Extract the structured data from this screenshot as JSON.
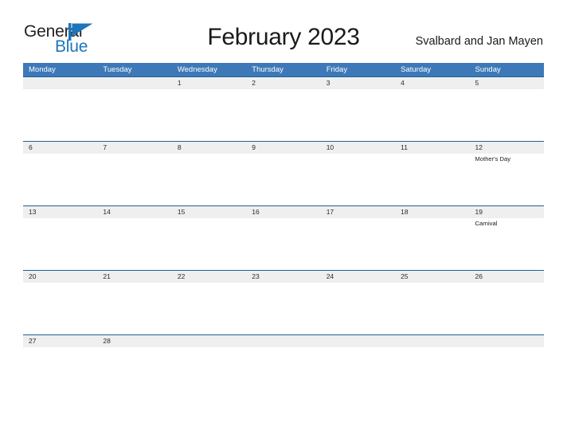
{
  "brand": {
    "name_part1": "General",
    "name_part2": "Blue",
    "flag_color": "#1b76bc",
    "text_color": "#231f20"
  },
  "header": {
    "title": "February 2023",
    "location": "Svalbard and Jan Mayen"
  },
  "theme": {
    "header_bar_color": "#3d79b8",
    "row_divider_color": "#1f6093",
    "date_strip_color": "#efefef",
    "page_background": "#ffffff"
  },
  "calendar": {
    "weekdays": [
      "Monday",
      "Tuesday",
      "Wednesday",
      "Thursday",
      "Friday",
      "Saturday",
      "Sunday"
    ],
    "weeks": [
      {
        "dates": [
          "",
          "",
          "1",
          "2",
          "3",
          "4",
          "5"
        ],
        "events": [
          "",
          "",
          "",
          "",
          "",
          "",
          ""
        ]
      },
      {
        "dates": [
          "6",
          "7",
          "8",
          "9",
          "10",
          "11",
          "12"
        ],
        "events": [
          "",
          "",
          "",
          "",
          "",
          "",
          "Mother's Day"
        ]
      },
      {
        "dates": [
          "13",
          "14",
          "15",
          "16",
          "17",
          "18",
          "19"
        ],
        "events": [
          "",
          "",
          "",
          "",
          "",
          "",
          "Carnival"
        ]
      },
      {
        "dates": [
          "20",
          "21",
          "22",
          "23",
          "24",
          "25",
          "26"
        ],
        "events": [
          "",
          "",
          "",
          "",
          "",
          "",
          ""
        ]
      },
      {
        "dates": [
          "27",
          "28",
          "",
          "",
          "",
          "",
          ""
        ],
        "events": [
          "",
          "",
          "",
          "",
          "",
          "",
          ""
        ]
      }
    ]
  }
}
